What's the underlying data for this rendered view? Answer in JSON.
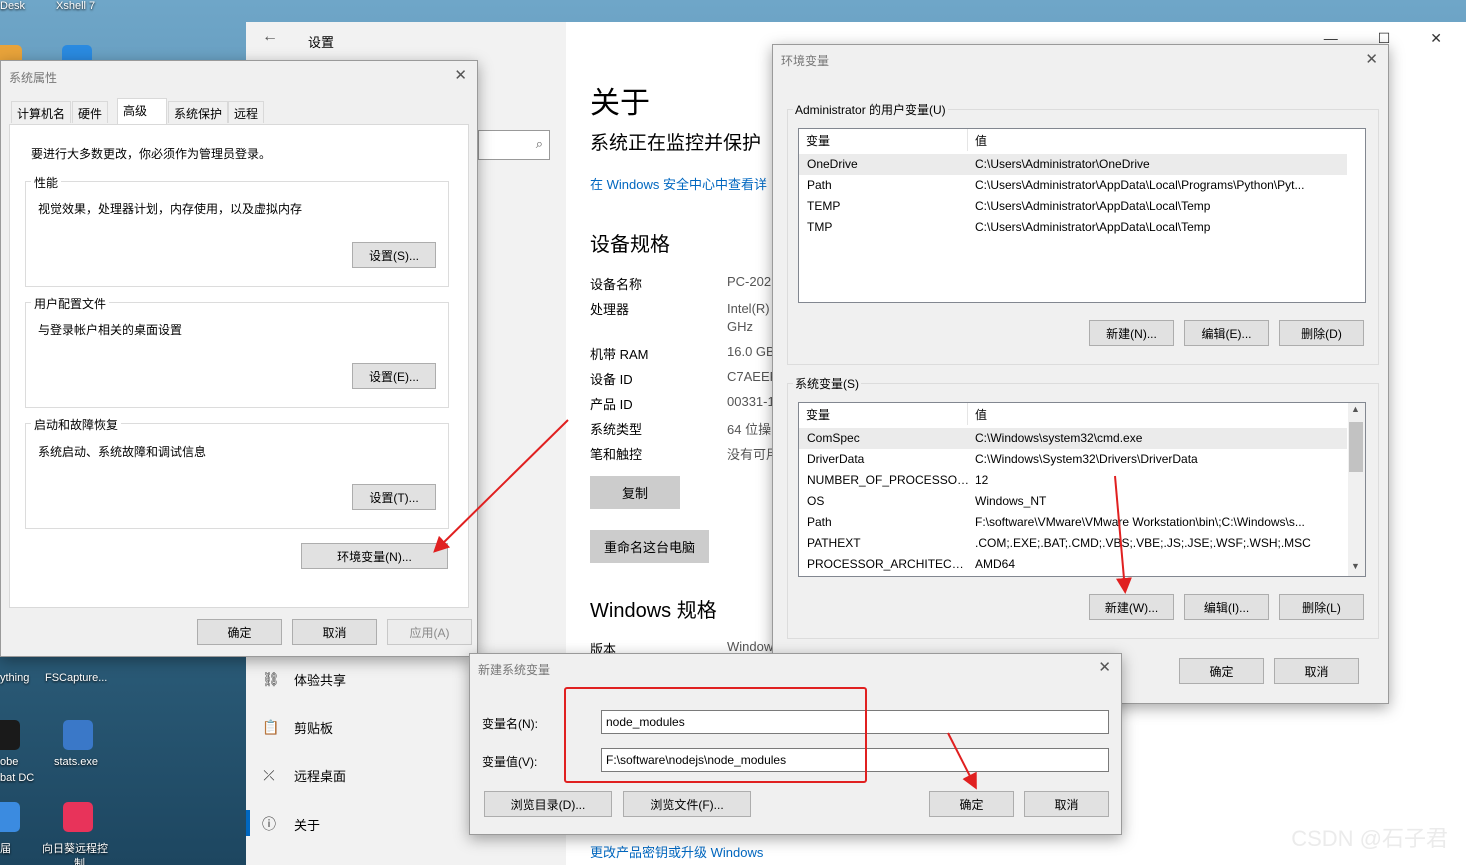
{
  "desktop": {
    "icons": [
      {
        "label": "Desk",
        "icon": "desktop-app-icon"
      },
      {
        "label": "Xshell 7",
        "icon": "xshell-icon"
      },
      {
        "label": "ything",
        "icon": "everything-icon"
      },
      {
        "label": "FSCapture...",
        "icon": "fscapture-icon"
      },
      {
        "label": "obe",
        "icon": "acrobat-icon"
      },
      {
        "label": "bat DC",
        "icon": "acrobat-icon"
      },
      {
        "label": "stats.exe",
        "icon": "stats-icon"
      },
      {
        "label": "届",
        "icon": "app-icon"
      },
      {
        "label": "向日葵远程控",
        "icon": "sunlogin-icon"
      },
      {
        "label": "制",
        "icon": "sunlogin-icon"
      }
    ]
  },
  "settings": {
    "title": "设置",
    "back_icon": "back-arrow-icon",
    "nav": [
      {
        "label": "体验共享",
        "icon": "share-icon"
      },
      {
        "label": "剪贴板",
        "icon": "clipboard-icon"
      },
      {
        "label": "远程桌面",
        "icon": "remote-desktop-icon"
      },
      {
        "label": "关于",
        "icon": "info-icon"
      }
    ],
    "page_title": "关于",
    "monitor_text": "系统正在监控并保护",
    "security_link": "在 Windows 安全中心中查看详",
    "device_spec_heading": "设备规格",
    "specs": [
      {
        "key": "设备名称",
        "value": "PC-202"
      },
      {
        "key": "处理器",
        "value": "Intel(R)"
      },
      {
        "key": "",
        "value": "GHz"
      },
      {
        "key": "机带 RAM",
        "value": "16.0 GB"
      },
      {
        "key": "设备 ID",
        "value": "C7AEEF"
      },
      {
        "key": "产品 ID",
        "value": "00331-1"
      },
      {
        "key": "系统类型",
        "value": "64 位操"
      },
      {
        "key": "笔和触控",
        "value": "没有可用"
      }
    ],
    "copy_button": "复制",
    "rename_button": "重命名这台电脑",
    "windows_spec_heading": "Windows 规格",
    "version_key": "版本",
    "version_value": "Window",
    "upgrade_link": "更改产品密钥或升级 Windows"
  },
  "system_properties": {
    "title": "系统属性",
    "tabs": [
      "计算机名",
      "硬件",
      "高级",
      "系统保护",
      "远程"
    ],
    "active_tab": "高级",
    "admin_note": "要进行大多数更改，你必须作为管理员登录。",
    "performance": {
      "label": "性能",
      "desc": "视觉效果，处理器计划，内存使用，以及虚拟内存",
      "button": "设置(S)..."
    },
    "user_profiles": {
      "label": "用户配置文件",
      "desc": "与登录帐户相关的桌面设置",
      "button": "设置(E)..."
    },
    "startup": {
      "label": "启动和故障恢复",
      "desc": "系统启动、系统故障和调试信息",
      "button": "设置(T)..."
    },
    "env_button": "环境变量(N)...",
    "ok": "确定",
    "cancel": "取消",
    "apply": "应用(A)"
  },
  "env_vars": {
    "title": "环境变量",
    "user_section": "Administrator 的用户变量(U)",
    "col_var": "变量",
    "col_val": "值",
    "user_vars": [
      {
        "name": "OneDrive",
        "value": "C:\\Users\\Administrator\\OneDrive"
      },
      {
        "name": "Path",
        "value": "C:\\Users\\Administrator\\AppData\\Local\\Programs\\Python\\Pyt..."
      },
      {
        "name": "TEMP",
        "value": "C:\\Users\\Administrator\\AppData\\Local\\Temp"
      },
      {
        "name": "TMP",
        "value": "C:\\Users\\Administrator\\AppData\\Local\\Temp"
      }
    ],
    "user_new": "新建(N)...",
    "user_edit": "编辑(E)...",
    "user_delete": "删除(D)",
    "sys_section": "系统变量(S)",
    "sys_vars": [
      {
        "name": "ComSpec",
        "value": "C:\\Windows\\system32\\cmd.exe"
      },
      {
        "name": "DriverData",
        "value": "C:\\Windows\\System32\\Drivers\\DriverData"
      },
      {
        "name": "NUMBER_OF_PROCESSORS",
        "value": "12"
      },
      {
        "name": "OS",
        "value": "Windows_NT"
      },
      {
        "name": "Path",
        "value": "F:\\software\\VMware\\VMware Workstation\\bin\\;C:\\Windows\\s..."
      },
      {
        "name": "PATHEXT",
        "value": ".COM;.EXE;.BAT;.CMD;.VBS;.VBE;.JS;.JSE;.WSF;.WSH;.MSC"
      },
      {
        "name": "PROCESSOR_ARCHITECT...",
        "value": "AMD64"
      }
    ],
    "sys_new": "新建(W)...",
    "sys_edit": "编辑(I)...",
    "sys_delete": "删除(L)",
    "ok": "确定",
    "cancel": "取消"
  },
  "new_var": {
    "title": "新建系统变量",
    "name_label": "变量名(N):",
    "name_value": "node_modules",
    "value_label": "变量值(V):",
    "value_value": "F:\\software\\nodejs\\node_modules",
    "browse_dir": "浏览目录(D)...",
    "browse_file": "浏览文件(F)...",
    "ok": "确定",
    "cancel": "取消"
  },
  "watermark": "CSDN @石子君",
  "annotation_color": "#e02020"
}
